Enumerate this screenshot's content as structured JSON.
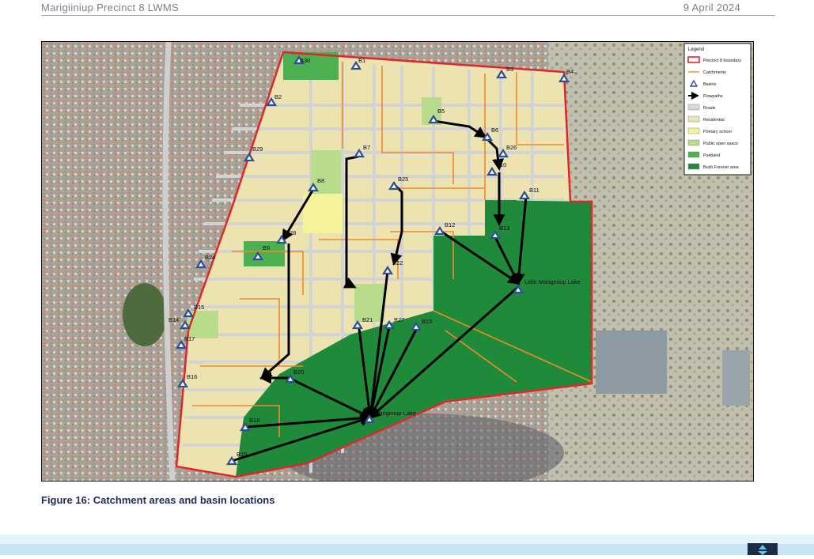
{
  "header": {
    "doc_title": "Marigiiniup Precinct 8 LWMS",
    "date": "9 April 2024"
  },
  "figure": {
    "caption": "Figure 16: Catchment areas and basin locations"
  },
  "legend": {
    "title": "Legend",
    "items": [
      {
        "label": "Precinct 8 boundary",
        "symbol": "boundary",
        "color": "#e0262b"
      },
      {
        "label": "Catchments",
        "symbol": "line",
        "color": "#f08a2a"
      },
      {
        "label": "Basins",
        "symbol": "basin-triangle",
        "color": "#2d4f9a"
      },
      {
        "label": "Flowpaths",
        "symbol": "arrow",
        "color": "#000000"
      },
      {
        "label": "Roads",
        "symbol": "fill",
        "color": "#d9d9d9"
      },
      {
        "label": "Residential",
        "symbol": "fill",
        "color": "#ece3b0"
      },
      {
        "label": "Primary school",
        "symbol": "fill",
        "color": "#f4f29a"
      },
      {
        "label": "Public open space",
        "symbol": "fill",
        "color": "#b9dc8a"
      },
      {
        "label": "Parkland",
        "symbol": "fill",
        "color": "#4caf50"
      },
      {
        "label": "Bush Forever area",
        "symbol": "fill",
        "color": "#1f8a3a"
      }
    ]
  },
  "basins": [
    "B1",
    "B2",
    "B3",
    "B4",
    "B5",
    "B6",
    "B7",
    "B8",
    "B9",
    "B10",
    "B11",
    "B12",
    "B13",
    "B14",
    "B15",
    "B16",
    "B17",
    "B18",
    "B19",
    "B20",
    "B21",
    "B22",
    "B23",
    "B24",
    "B25",
    "B26",
    "B27",
    "B28",
    "B29",
    "B30"
  ],
  "lakes": [
    "Little Mariginiup Lake",
    "Mariginiup Lake"
  ]
}
